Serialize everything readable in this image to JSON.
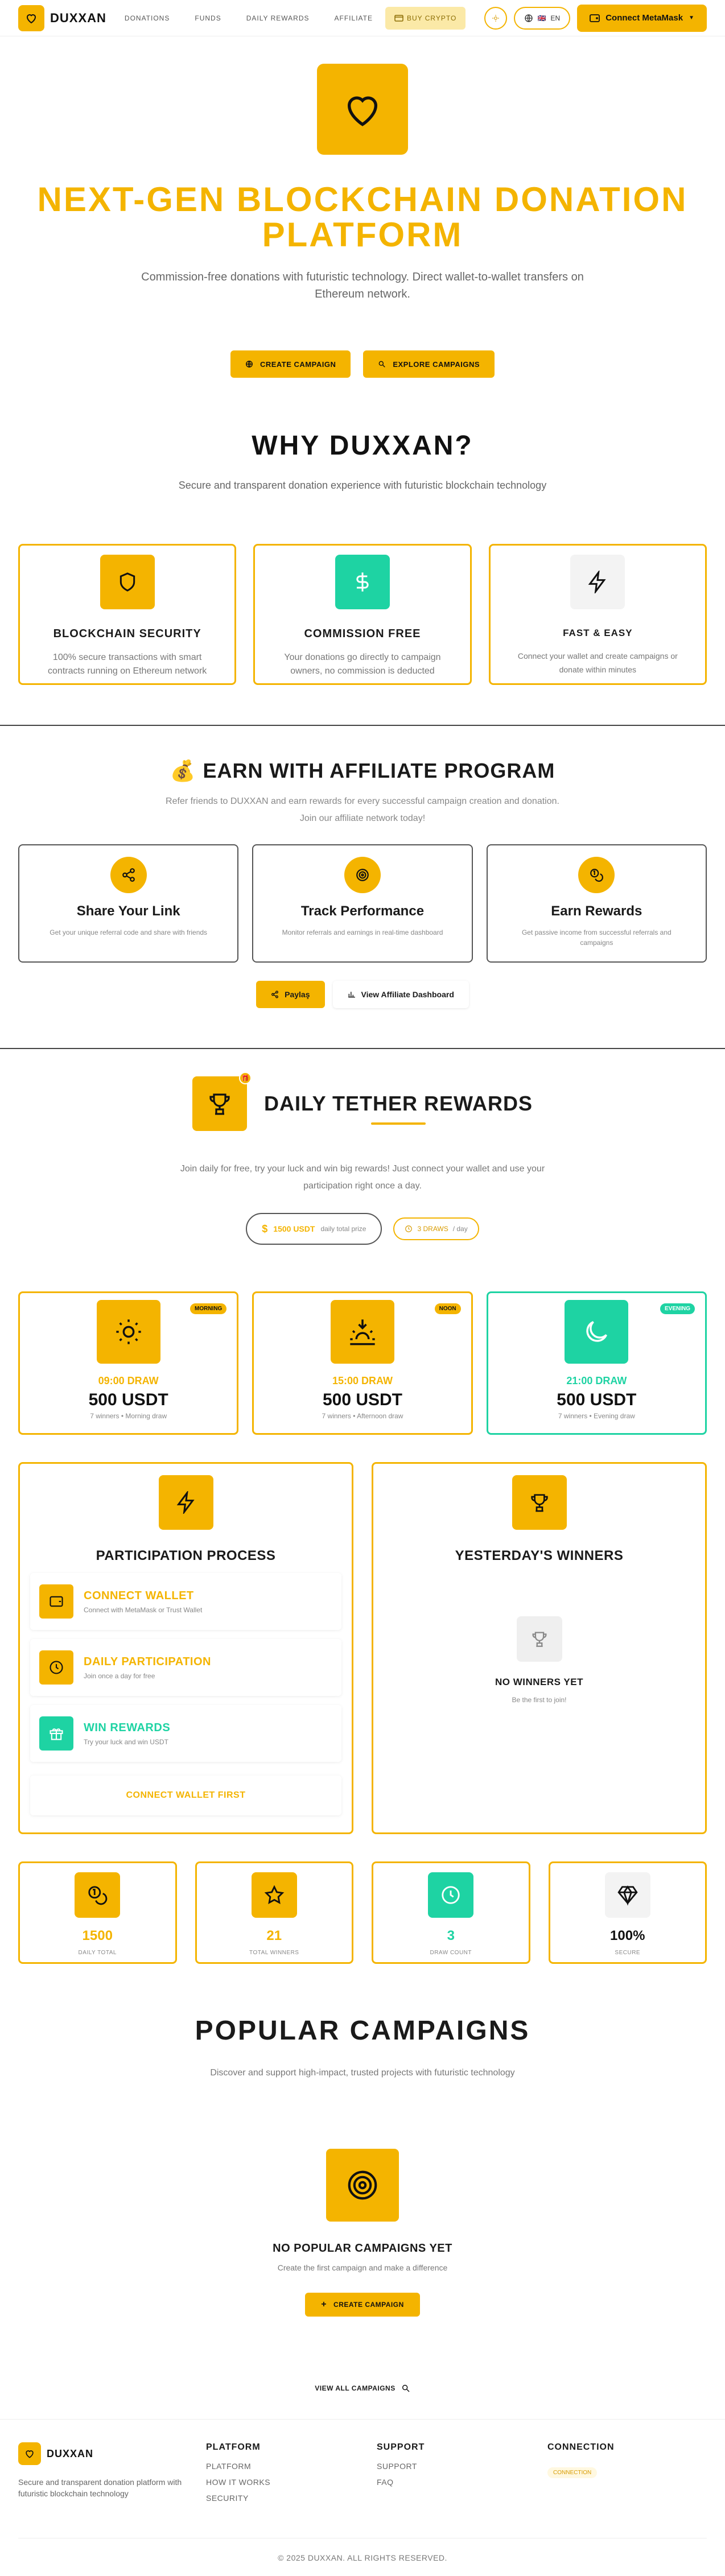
{
  "header": {
    "logo_text": "DUXXAN",
    "nav": [
      "DONATIONS",
      "FUNDS",
      "DAILY REWARDS",
      "AFFILIATE"
    ],
    "buy_crypto": "BUY CRYPTO",
    "lang": "EN",
    "metamask": "Connect MetaMask"
  },
  "hero": {
    "title": "NEXT-GEN BLOCKCHAIN DONATION PLATFORM",
    "subtitle": "Commission-free donations with futuristic technology. Direct wallet-to-wallet transfers on Ethereum network.",
    "create": "CREATE CAMPAIGN",
    "explore": "EXPLORE CAMPAIGNS"
  },
  "why": {
    "title": "WHY DUXXAN?",
    "subtitle": "Secure and transparent donation experience with futuristic blockchain technology",
    "cards": [
      {
        "title": "BLOCKCHAIN SECURITY",
        "desc": "100% secure transactions with smart contracts running on Ethereum network"
      },
      {
        "title": "COMMISSION FREE",
        "desc": "Your donations go directly to campaign owners, no commission is deducted"
      },
      {
        "title": "FAST & EASY",
        "desc": "Connect your wallet and create campaigns or donate within minutes"
      }
    ]
  },
  "affiliate": {
    "emoji": "💰",
    "title": "EARN WITH AFFILIATE PROGRAM",
    "subtitle1": "Refer friends to DUXXAN and earn rewards for every successful campaign creation and donation.",
    "subtitle2": "Join our affiliate network today!",
    "cards": [
      {
        "title": "Share Your Link",
        "desc": "Get your unique referral code and share with friends"
      },
      {
        "title": "Track Performance",
        "desc": "Monitor referrals and earnings in real-time dashboard"
      },
      {
        "title": "Earn Rewards",
        "desc": "Get passive income from successful referrals and campaigns"
      }
    ],
    "share_btn": "Paylaş",
    "dash_btn": "View Affiliate Dashboard"
  },
  "tether": {
    "title": "DAILY TETHER REWARDS",
    "subtitle": "Join daily for free, try your luck and win big rewards! Just connect your wallet and use your participation right once a day.",
    "prize_amount": "1500 USDT",
    "prize_label": "daily total prize",
    "draws_count": "3 DRAWS",
    "draws_label": "/ day",
    "draws": [
      {
        "tag": "MORNING",
        "time": "09:00 DRAW",
        "amount": "500 USDT",
        "info": "7 winners • Morning draw"
      },
      {
        "tag": "NOON",
        "time": "15:00 DRAW",
        "amount": "500 USDT",
        "info": "7 winners • Afternoon draw"
      },
      {
        "tag": "EVENING",
        "time": "21:00 DRAW",
        "amount": "500 USDT",
        "info": "7 winners • Evening draw"
      }
    ],
    "process_title": "PARTICIPATION PROCESS",
    "steps": [
      {
        "title": "CONNECT WALLET",
        "desc": "Connect with MetaMask or Trust Wallet"
      },
      {
        "title": "DAILY PARTICIPATION",
        "desc": "Join once a day for free"
      },
      {
        "title": "WIN REWARDS",
        "desc": "Try your luck and win USDT"
      }
    ],
    "connect_first": "CONNECT WALLET FIRST",
    "winners_title": "YESTERDAY'S WINNERS",
    "no_winners": "NO WINNERS YET",
    "be_first": "Be the first to join!",
    "stats": [
      {
        "value": "1500",
        "label": "DAILY TOTAL"
      },
      {
        "value": "21",
        "label": "TOTAL WINNERS"
      },
      {
        "value": "3",
        "label": "DRAW COUNT"
      },
      {
        "value": "100%",
        "label": "SECURE"
      }
    ]
  },
  "popular": {
    "title": "POPULAR CAMPAIGNS",
    "subtitle": "Discover and support high-impact, trusted projects with futuristic technology",
    "empty_title": "NO POPULAR CAMPAIGNS YET",
    "empty_desc": "Create the first campaign and make a difference",
    "create": "CREATE CAMPAIGN",
    "view_all": "VIEW ALL CAMPAIGNS"
  },
  "footer": {
    "logo_text": "DUXXAN",
    "desc": "Secure and transparent donation platform with futuristic blockchain technology",
    "platform_title": "PLATFORM",
    "platform_links": [
      "PLATFORM",
      "HOW IT WORKS",
      "SECURITY"
    ],
    "support_title": "SUPPORT",
    "support_links": [
      "SUPPORT",
      "FAQ"
    ],
    "connection_title": "CONNECTION",
    "connection_pill": "CONNECTION",
    "copyright": "© 2025 DUXXAN. ALL RIGHTS RESERVED."
  },
  "colors": {
    "accent": "#f4b400",
    "teal": "#1ed3a3",
    "dark": "#111111"
  }
}
